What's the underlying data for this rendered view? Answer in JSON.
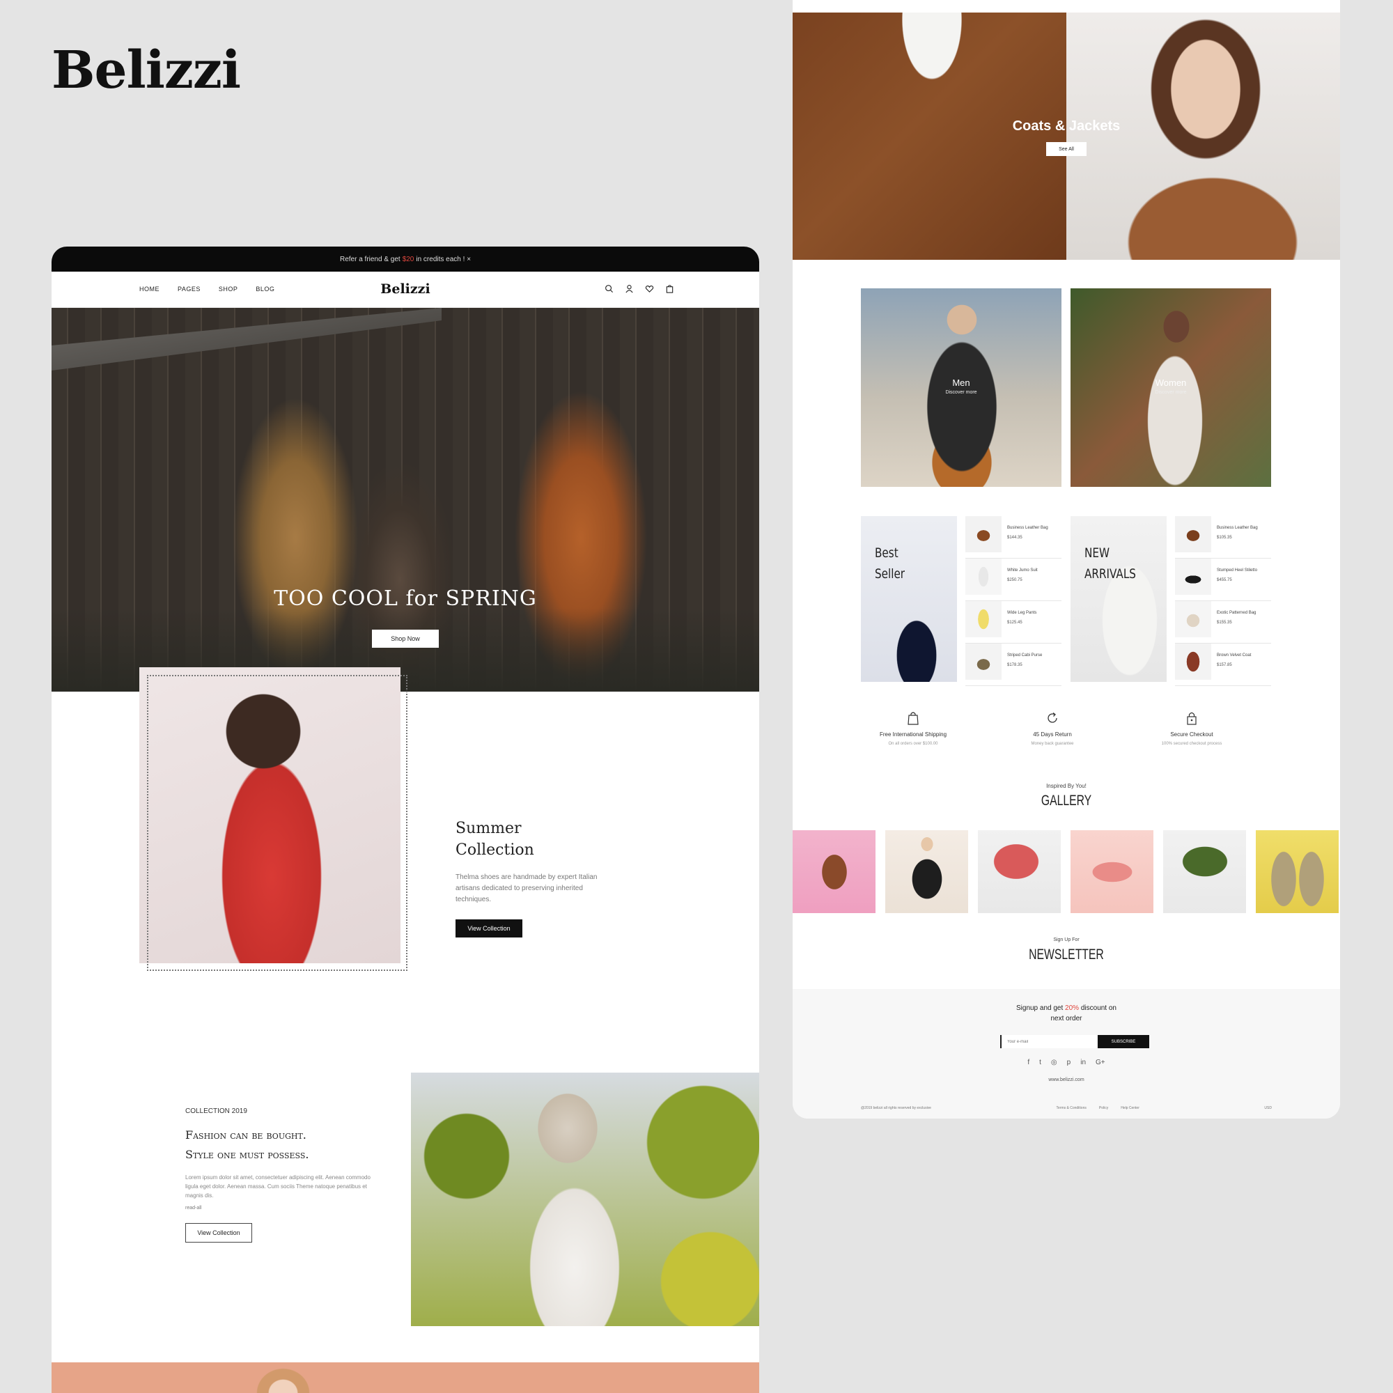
{
  "brand": "Belizzi",
  "colors": {
    "accent_red": "#e0473e",
    "dark": "#111111",
    "bg": "#e4e4e4",
    "hero_rust": "#b5612a"
  },
  "home": {
    "promo": {
      "prefix": "Refer a friend & get",
      "amount": "$20",
      "suffix": "in credits each ! ×"
    },
    "nav": {
      "items": [
        "HOME",
        "PAGES",
        "SHOP",
        "BLOG"
      ],
      "logo": "Belizzi",
      "icons": [
        "search-icon",
        "user-icon",
        "heart-icon",
        "bag-icon"
      ]
    },
    "hero": {
      "title": "TOO COOL for SPRING",
      "button": "Shop Now"
    },
    "summer": {
      "title_line1": "Summer",
      "title_line2": "Collection",
      "desc": "Thelma shoes are handmade by expert Italian artisans dedicated to preserving inherited techniques.",
      "button": "View Collection"
    },
    "collection": {
      "year": "COLLECTION 2019",
      "title_line1": "Fashion can be bought.",
      "title_line2": "Style one must possess.",
      "desc": "Lorem ipsum dolor sit amet, consectetuer adipiscing elit. Aenean commodo ligula eget dolor. Aenean massa. Cum sociis Theme natoque penatibus et magnis dis.",
      "more": "read-all",
      "button": "View Collection"
    }
  },
  "shop": {
    "coats": {
      "title": "Coats & Jackets",
      "button": "See All"
    },
    "categories": [
      {
        "label": "Men",
        "sub": "Discover more"
      },
      {
        "label": "Women",
        "sub": "Discover more"
      }
    ],
    "best_seller": {
      "title_line1": "Best",
      "title_line2": "Seller",
      "products": [
        {
          "name": "Business Leather Bag",
          "price": "$144.35"
        },
        {
          "name": "White Jumo Suit",
          "price": "$250.75"
        },
        {
          "name": "Wide Leg Pants",
          "price": "$125.45"
        },
        {
          "name": "Striped Cabi Purse",
          "price": "$178.35"
        }
      ]
    },
    "new_arrivals": {
      "title_line1": "NEW",
      "title_line2": "ARRIVALS",
      "products": [
        {
          "name": "Business Leather Bag",
          "price": "$105.35"
        },
        {
          "name": "Stumped Heel Stiletto",
          "price": "$455.75"
        },
        {
          "name": "Exotic Patterned Bag",
          "price": "$155.35"
        },
        {
          "name": "Brown Velvet Coat",
          "price": "$157.85"
        }
      ]
    },
    "features": [
      {
        "icon": "bag-icon",
        "title": "Free International Shipping",
        "sub": "On all orders over $100.00"
      },
      {
        "icon": "return-icon",
        "title": "45 Days Return",
        "sub": "Money back guarantee"
      },
      {
        "icon": "lock-icon",
        "title": "Secure Checkout",
        "sub": "100% secured checkout process"
      }
    ],
    "gallery": {
      "sub": "Inspired By You!",
      "title": "GALLERY"
    },
    "newsletter": {
      "sub": "Sign Up For",
      "title": "NEWSLETTER",
      "head_prefix": "Signup and get",
      "discount": "20%",
      "head_suffix": "discount on",
      "head_line2": "next order",
      "input_placeholder": "Your e-mail",
      "button": "SUBSCRIBE"
    },
    "socials": [
      "f",
      "t",
      "◎",
      "p",
      "in",
      "G+"
    ],
    "site_url": "www.belizzi.com",
    "footer": {
      "copyright": "@2019 belizzi all rights reserved by exclusive",
      "links": [
        "Terms & Conditions",
        "Policy",
        "Help Center"
      ],
      "lang": "USD"
    }
  }
}
